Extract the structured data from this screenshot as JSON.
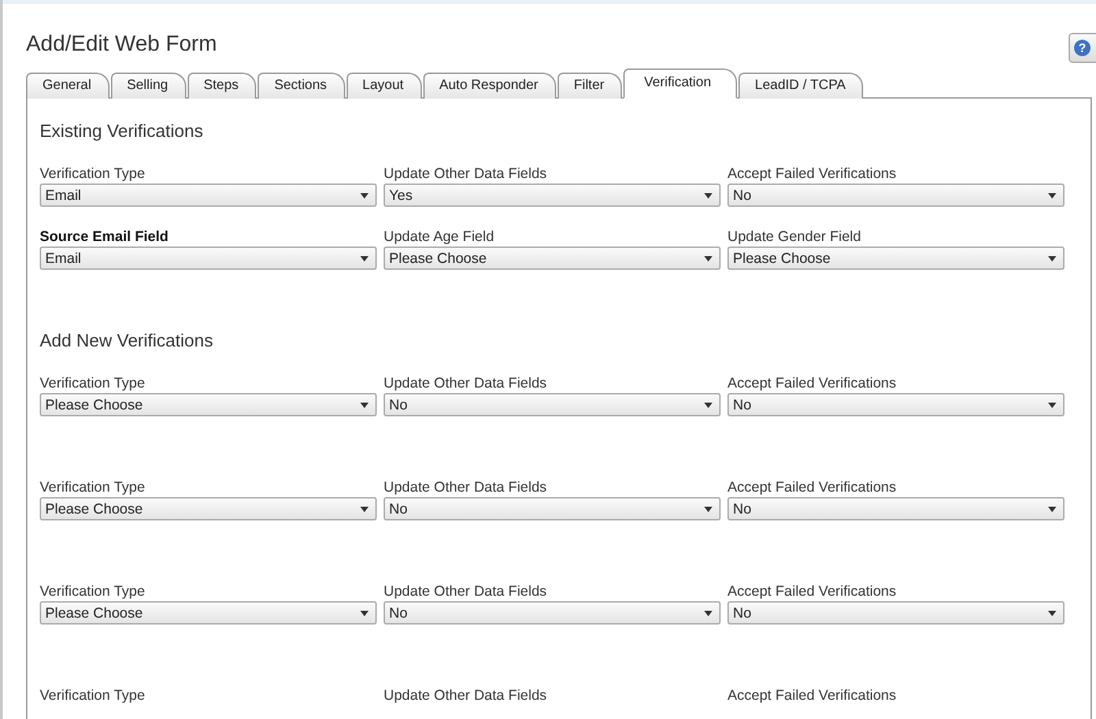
{
  "page": {
    "title": "Add/Edit Web Form"
  },
  "help_button": {
    "label": "?"
  },
  "tabs": [
    {
      "label": "General",
      "selected": false
    },
    {
      "label": "Selling",
      "selected": false
    },
    {
      "label": "Steps",
      "selected": false
    },
    {
      "label": "Sections",
      "selected": false
    },
    {
      "label": "Layout",
      "selected": false
    },
    {
      "label": "Auto Responder",
      "selected": false
    },
    {
      "label": "Filter",
      "selected": false
    },
    {
      "label": "Verification",
      "selected": true
    },
    {
      "label": "LeadID / TCPA",
      "selected": false
    }
  ],
  "sections": [
    {
      "heading": "Existing Verifications",
      "rows": [
        {
          "fields": [
            {
              "label": "Verification Type",
              "bold": false,
              "value": "Email"
            },
            {
              "label": "Update Other Data Fields",
              "bold": false,
              "value": "Yes"
            },
            {
              "label": "Accept Failed Verifications",
              "bold": false,
              "value": "No"
            }
          ]
        },
        {
          "fields": [
            {
              "label": "Source Email Field",
              "bold": true,
              "value": "Email"
            },
            {
              "label": "Update Age Field",
              "bold": false,
              "value": "Please Choose"
            },
            {
              "label": "Update Gender Field",
              "bold": false,
              "value": "Please Choose"
            }
          ]
        }
      ]
    },
    {
      "heading": "Add New Verifications",
      "rows": [
        {
          "fields": [
            {
              "label": "Verification Type",
              "bold": false,
              "value": "Please Choose"
            },
            {
              "label": "Update Other Data Fields",
              "bold": false,
              "value": "No"
            },
            {
              "label": "Accept Failed Verifications",
              "bold": false,
              "value": "No"
            }
          ]
        },
        {
          "fields": [
            {
              "label": "Verification Type",
              "bold": false,
              "value": "Please Choose"
            },
            {
              "label": "Update Other Data Fields",
              "bold": false,
              "value": "No"
            },
            {
              "label": "Accept Failed Verifications",
              "bold": false,
              "value": "No"
            }
          ]
        },
        {
          "fields": [
            {
              "label": "Verification Type",
              "bold": false,
              "value": "Please Choose"
            },
            {
              "label": "Update Other Data Fields",
              "bold": false,
              "value": "No"
            },
            {
              "label": "Accept Failed Verifications",
              "bold": false,
              "value": "No"
            }
          ]
        },
        {
          "fields": [
            {
              "label": "Verification Type",
              "bold": false
            },
            {
              "label": "Update Other Data Fields",
              "bold": false
            },
            {
              "label": "Accept Failed Verifications",
              "bold": false
            }
          ]
        }
      ]
    }
  ]
}
